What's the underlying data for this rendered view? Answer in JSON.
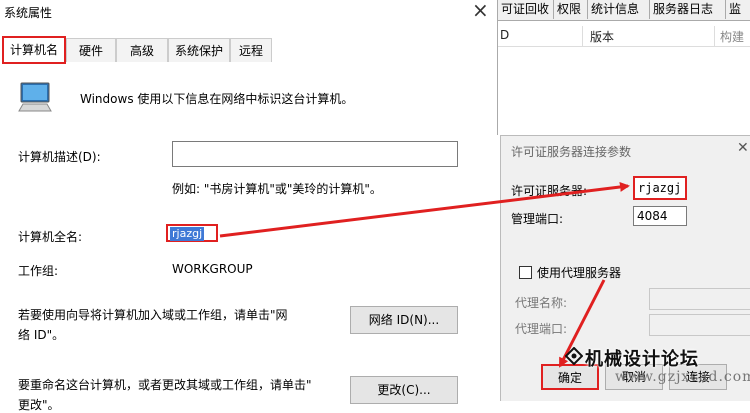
{
  "system_window": {
    "title": "系统属性",
    "close_glyph": "×",
    "tabs": [
      "计算机名",
      "硬件",
      "高级",
      "系统保护",
      "远程"
    ],
    "description": "Windows 使用以下信息在网络中标识这台计算机。",
    "desc_label": "计算机描述(D):",
    "desc_value": "",
    "desc_example": "例如: \"书房计算机\"或\"美玲的计算机\"。",
    "full_name_label": "计算机全名:",
    "full_name_value": "rjazgj",
    "workgroup_label": "工作组:",
    "workgroup_value": "WORKGROUP",
    "join_text_1": "若要使用向导将计算机加入域或工作组，请单击\"网",
    "join_text_2": "络 ID\"。",
    "network_id_button": "网络 ID(N)...",
    "rename_text_1": "要重命名这台计算机，或者更改其域或工作组，请单击\"",
    "rename_text_2": "更改\"。",
    "change_button": "更改(C)..."
  },
  "background_app": {
    "menu": [
      "可证回收",
      "权限",
      "统计信息",
      "服务器日志",
      "监"
    ],
    "columns": [
      "D",
      "版本",
      "构建"
    ]
  },
  "dialog": {
    "title": "许可证服务器连接参数",
    "close_glyph": "✕",
    "server_label": "许可证服务器:",
    "server_value": "rjazgj",
    "port_label": "管理端口:",
    "port_value": "4084",
    "proxy_label": "使用代理服务器",
    "proxy_checked": false,
    "proxy_name_label": "代理名称:",
    "proxy_name_value": "",
    "proxy_port_label": "代理端口:",
    "proxy_port_value": "",
    "ok_button": "确定",
    "cancel_button": "取消",
    "connect_button": "连接"
  },
  "annotation_color": "#e02020",
  "watermark": {
    "text": "机械设计论坛",
    "url": "www.gzjxcad.com"
  }
}
